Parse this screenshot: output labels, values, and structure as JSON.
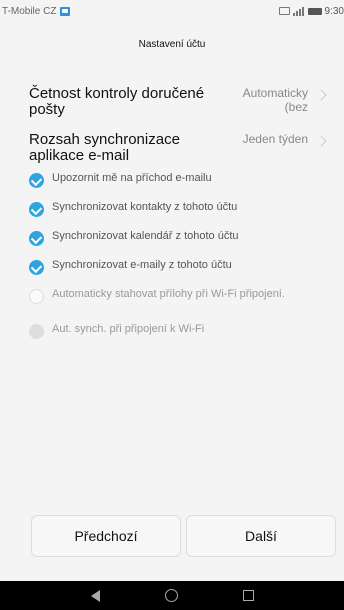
{
  "status": {
    "carrier": "T-Mobile CZ",
    "time": "9:30"
  },
  "header": {
    "title": "Nastavení účtu"
  },
  "settings": [
    {
      "label": "Četnost kontroly doručené pošty",
      "value": "Automaticky (bez"
    },
    {
      "label": "Rozsah synchronizace aplikace e-mail",
      "value": "Jeden týden"
    }
  ],
  "checks": [
    {
      "label": "Upozornit mě na příchod e-mailu",
      "state": "checked"
    },
    {
      "label": "Synchronizovat kontakty z tohoto účtu",
      "state": "checked"
    },
    {
      "label": "Synchronizovat kalendář z tohoto účtu",
      "state": "checked"
    },
    {
      "label": "Synchronizovat e-maily z tohoto účtu",
      "state": "checked"
    },
    {
      "label": "Automaticky stahovat přílohy při Wi-Fi připojení.",
      "state": "unchecked"
    },
    {
      "label": "Aut. synch. při připojení k Wi-Fi",
      "state": "disabled"
    }
  ],
  "buttons": {
    "previous": "Předchozí",
    "next": "Další"
  },
  "colors": {
    "accent": "#2ea5e0",
    "nav_bar": "#000000"
  }
}
